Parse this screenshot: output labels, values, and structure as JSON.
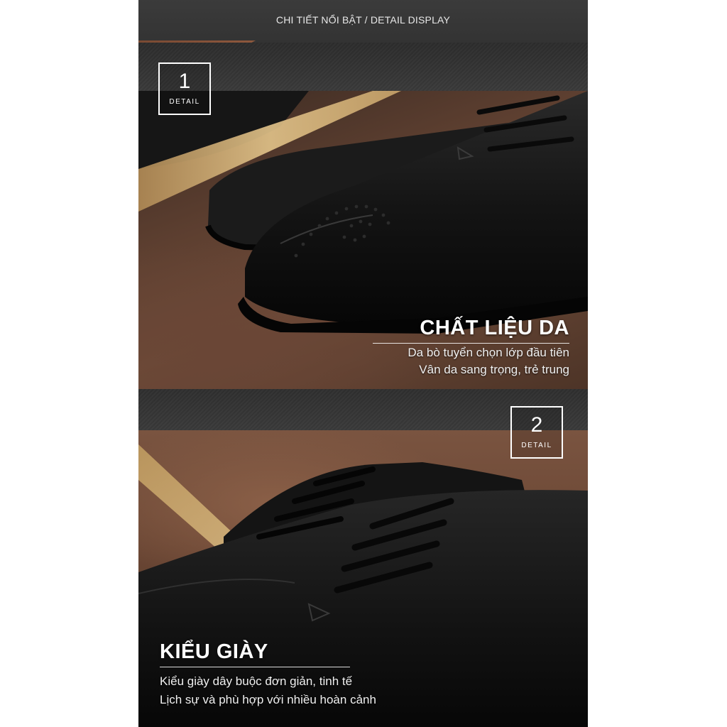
{
  "header": {
    "title": "CHI TIẾT NỔI BẬT  / DETAIL DISPLAY"
  },
  "section1": {
    "badge_number": "1",
    "badge_label": "DETAIL",
    "title": "CHẤT LIỆU DA",
    "lines": [
      "Da bò tuyển chọn lớp đầu tiên",
      "Vân da sang trọng, trẻ trung"
    ]
  },
  "section2": {
    "badge_number": "2",
    "badge_label": "DETAIL",
    "title": "KIỂU GIÀY",
    "lines": [
      "Kiểu giày dây buộc đơn giản, tinh tế",
      "Lịch sự và phù hợp với nhiều hoàn cảnh"
    ]
  },
  "colors": {
    "accent": "#8e583d",
    "dark": "#2a2a2a",
    "leather": "#0f0f0f"
  }
}
